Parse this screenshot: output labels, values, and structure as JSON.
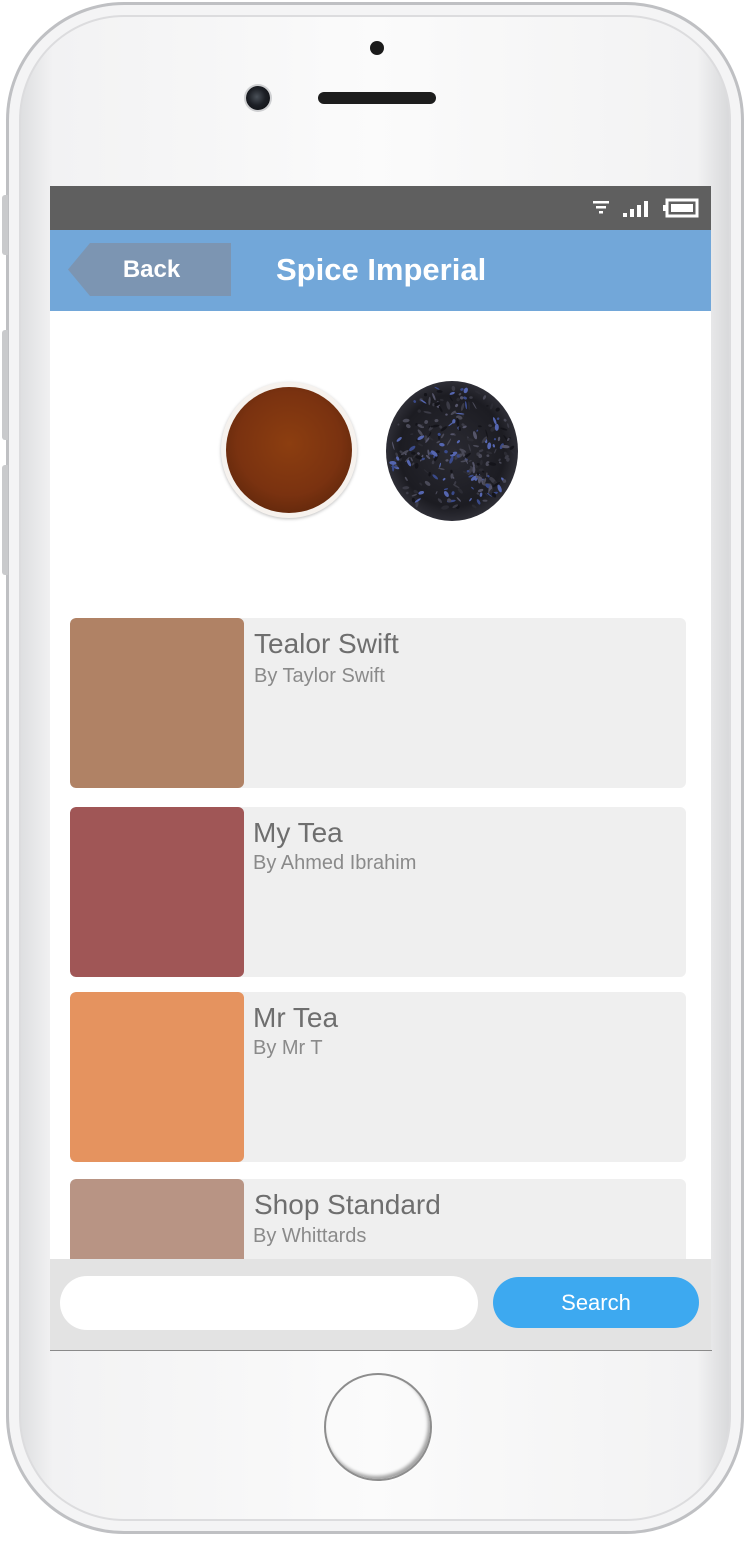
{
  "header": {
    "back_label": "Back",
    "title": "Spice Imperial"
  },
  "status_bar": {
    "icons": [
      "wifi-icon",
      "signal-icon",
      "battery-icon"
    ]
  },
  "product": {
    "images": [
      "brewed-tea-image",
      "loose-tea-leaves-image"
    ]
  },
  "blends": [
    {
      "name": "Tealor Swift",
      "by": "By Taylor Swift",
      "color": "#b08265"
    },
    {
      "name": "My Tea",
      "by": "By Ahmed Ibrahim",
      "color": "#a05656"
    },
    {
      "name": "Mr Tea",
      "by": "By Mr T",
      "color": "#e5935f"
    },
    {
      "name": "Shop Standard",
      "by": "By Whittards",
      "color": "#b89484"
    }
  ],
  "search": {
    "placeholder": "",
    "button_label": "Search"
  },
  "colors": {
    "status_bar": "#5f5f5f",
    "title_bar": "#72a7d9",
    "back_button": "#7c95b2",
    "search_button": "#3da9f0"
  }
}
